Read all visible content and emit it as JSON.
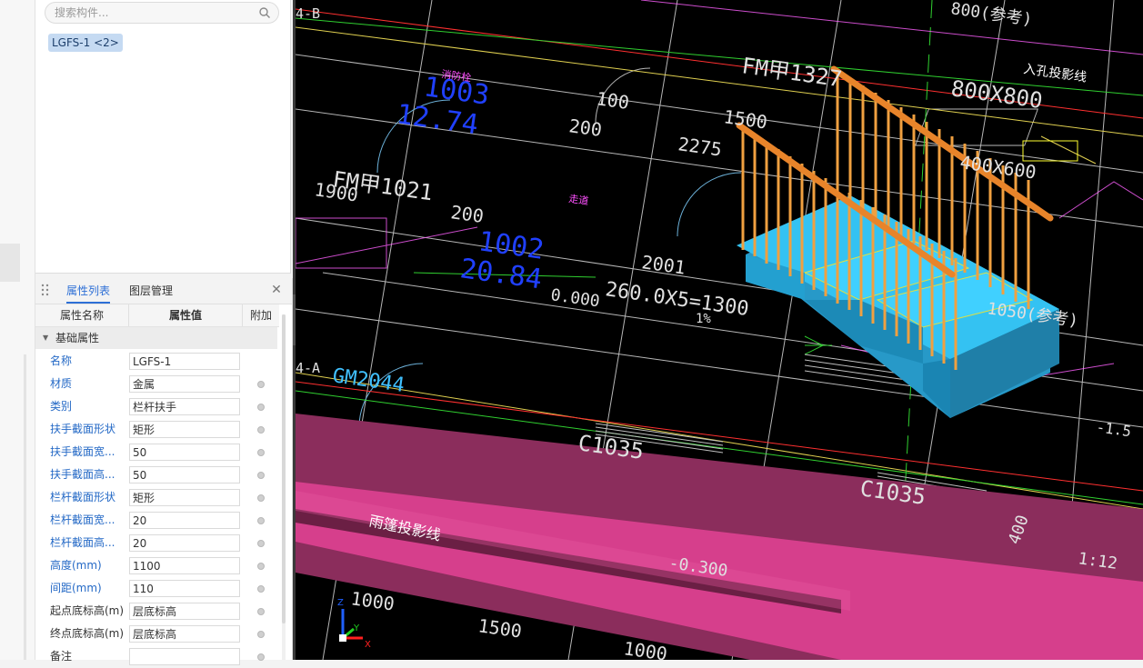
{
  "component_panel": {
    "search_placeholder": "搜索构件...",
    "selected_item": "LGFS-1 <2>"
  },
  "property_panel": {
    "tabs": [
      "属性列表",
      "图层管理"
    ],
    "columns": [
      "属性名称",
      "属性值",
      "附加"
    ],
    "group": "基础属性",
    "rows": [
      {
        "name": "名称",
        "value": "LGFS-1"
      },
      {
        "name": "材质",
        "value": "金属"
      },
      {
        "name": "类别",
        "value": "栏杆扶手"
      },
      {
        "name": "扶手截面形状",
        "value": "矩形"
      },
      {
        "name": "扶手截面宽...",
        "value": "50"
      },
      {
        "name": "扶手截面高...",
        "value": "50"
      },
      {
        "name": "栏杆截面形状",
        "value": "矩形"
      },
      {
        "name": "栏杆截面宽...",
        "value": "20"
      },
      {
        "name": "栏杆截面高...",
        "value": "20"
      },
      {
        "name": "高度(mm)",
        "value": "1100"
      },
      {
        "name": "间距(mm)",
        "value": "110"
      },
      {
        "name": "起点底标高(m)",
        "value": "层底标高"
      },
      {
        "name": "终点底标高(m)",
        "value": "层底标高"
      },
      {
        "name": "备注",
        "value": ""
      }
    ]
  },
  "viewport": {
    "labels": {
      "axis_4b": "4-B",
      "axis_4a": "4-A",
      "fm1327": "FM甲1327",
      "fm1021": "FM甲1021",
      "fm_size": "800X800",
      "door_2044": "GM2044",
      "c1035_a": "C1035",
      "c1035_b": "C1035",
      "rain_cover": "雨篷投影线",
      "rain_note": "入孔投影线",
      "dim_100": "100",
      "dim_200": "200",
      "dim_1500": "1500",
      "dim_2275": "2275",
      "dim_1900": "1900",
      "dim_200b": "200",
      "dim_2001": "2001",
      "dim_stairs": "260.0X5=1300",
      "slope": "1%",
      "elev_000": "0.000",
      "elev_m300": "-0.300",
      "blue_1003": "1003",
      "blue_1274": "12.74",
      "blue_1002": "1002",
      "blue_2084": "20.84",
      "dim_1000": "1000",
      "dim_1500b": "1500",
      "dim_1000b": "1000",
      "dim_1050": "1050(参考)",
      "dim_800ref": "800(参考)",
      "dim_400": "400",
      "scale": "1:12",
      "label_600": "400X600",
      "tiny_red": "消防栓",
      "tiny_mag": "走道",
      "dim_1": "-1.5"
    },
    "colors": {
      "stair": "#2fb8e6",
      "railing": "#f0a040",
      "slab": "#d63f8c"
    },
    "axis_icon_labels": {
      "x": "X",
      "y": "Y",
      "z": "Z"
    }
  }
}
